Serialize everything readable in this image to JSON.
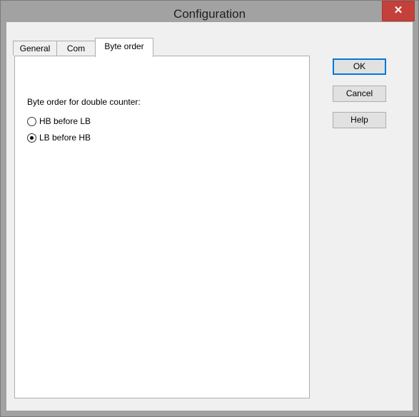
{
  "window": {
    "title": "Configuration",
    "close_symbol": "✕"
  },
  "tabs": [
    {
      "label": "General",
      "active": false
    },
    {
      "label": "Com",
      "active": false
    },
    {
      "label": "Byte order",
      "active": true
    }
  ],
  "byte_order": {
    "group_label": "Byte order for double counter:",
    "options": [
      {
        "label": "HB before LB",
        "checked": false
      },
      {
        "label": "LB before HB",
        "checked": true
      }
    ]
  },
  "buttons": {
    "ok": "OK",
    "cancel": "Cancel",
    "help": "Help"
  }
}
